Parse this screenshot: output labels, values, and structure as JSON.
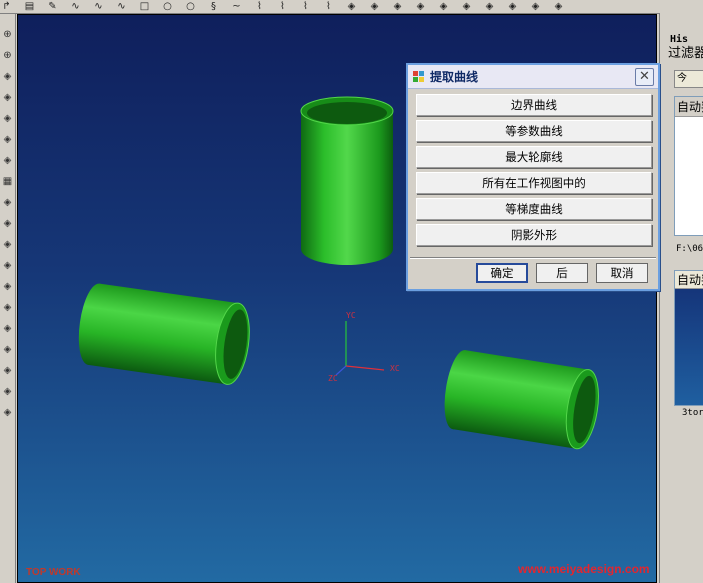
{
  "toolbar": {
    "top_icons": [
      "doc-arrow-icon",
      "doc-icon",
      "edit-icon",
      "curve-icon",
      "curve-icon",
      "curve-icon",
      "square-icon",
      "circle-icon",
      "circle-icon",
      "helix-icon",
      "tilde-icon",
      "line-icon",
      "line-icon",
      "line-icon",
      "line-icon",
      "shape-icon",
      "shape-icon",
      "shape-icon",
      "shape-icon",
      "shape-icon",
      "shape-icon",
      "shape-icon",
      "shape-icon",
      "shape-icon",
      "shape-icon"
    ],
    "left_icons": [
      "sphere-icon",
      "sphere-icon",
      "shape-icon",
      "shape-icon",
      "shape-icon",
      "shape-icon",
      "shape-icon",
      "grid-icon",
      "shape-icon",
      "shape-icon",
      "shape-icon",
      "shape-icon",
      "shape-icon",
      "shape-icon",
      "shape-icon",
      "shape-icon",
      "shape-icon",
      "shape-icon",
      "shape-icon"
    ]
  },
  "viewport": {
    "axes": {
      "x": "XC",
      "y": "YC",
      "z": "ZC"
    },
    "watermark_left": "TOP WORK",
    "watermark_right": "www.meiyadesign.com",
    "colors": {
      "cylinder": "#22a51f",
      "x_axis": "#e0303a",
      "y_axis": "#27c43a",
      "z_axis": "#3a55d8"
    }
  },
  "dialog": {
    "title": "提取曲线",
    "close": "✕",
    "options": [
      "边界曲线",
      "等参数曲线",
      "最大轮廓线",
      "所有在工作视图中的",
      "等梯度曲线",
      "阴影外形"
    ],
    "ok": "确定",
    "back": "后",
    "cancel": "取消"
  },
  "right_panel": {
    "title": "His",
    "filter": "过滤器",
    "folder": "今",
    "box1_header": "自动判",
    "path": "F:\\06",
    "box2_header": "自动判",
    "footer": "3tor"
  }
}
